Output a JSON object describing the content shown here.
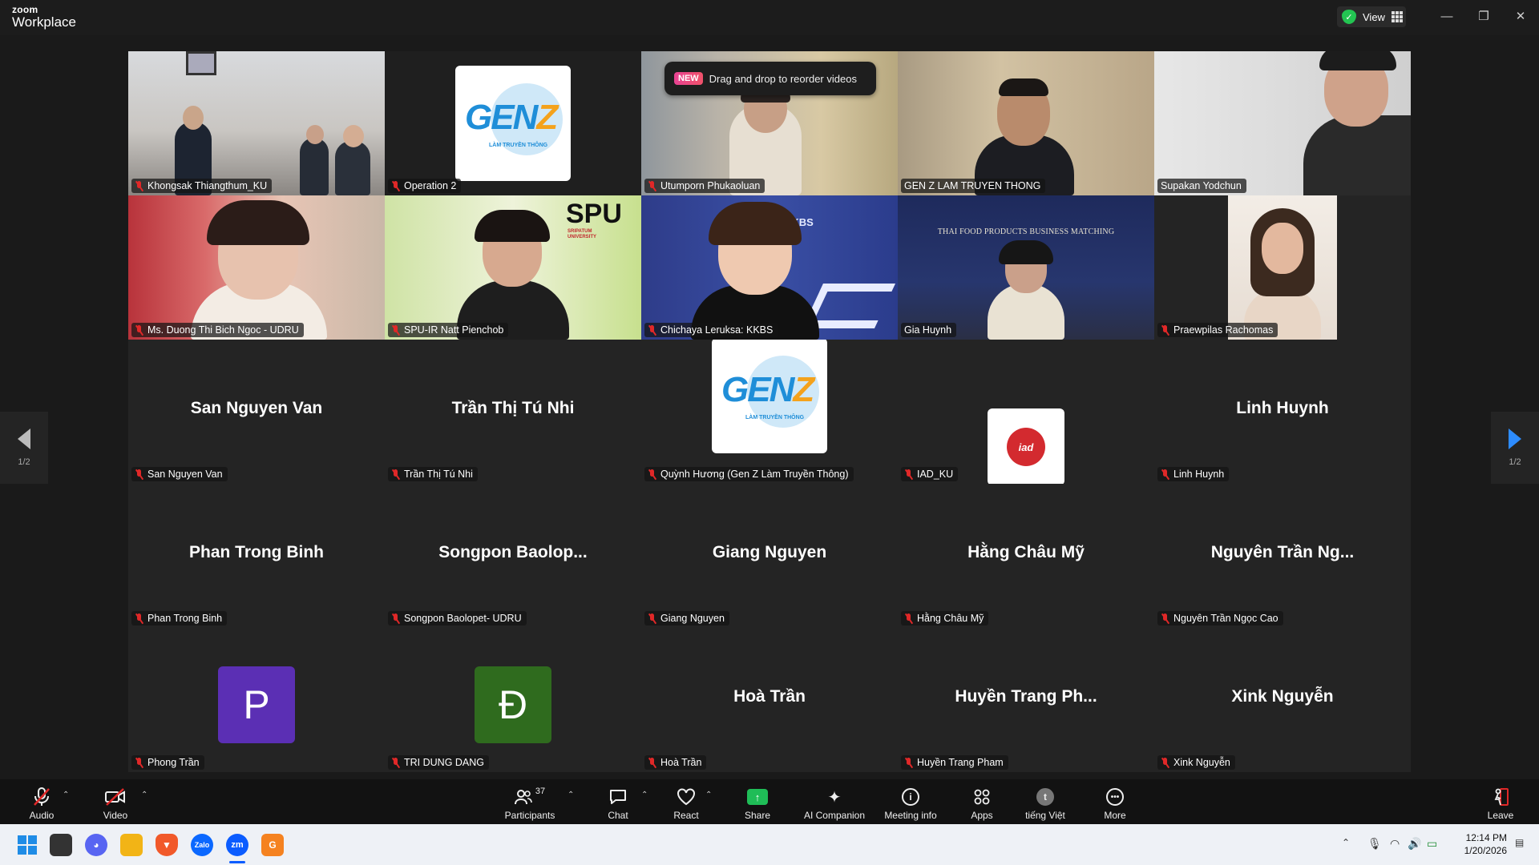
{
  "window": {
    "logo_small": "zoom",
    "logo_big": "Workplace",
    "view_label": "View",
    "minimize": "—",
    "restore": "❐",
    "close": "✕"
  },
  "toast": {
    "badge": "NEW",
    "text": "Drag and drop to reorder videos"
  },
  "pager": {
    "left_label": "1/2",
    "right_label": "1/2"
  },
  "video_tiles": [
    {
      "name": "Khongsak Thiangthum_KU",
      "muted": true
    },
    {
      "name": "Operation 2",
      "muted": true
    },
    {
      "name": "Utumporn Phukaoluan",
      "muted": true
    },
    {
      "name": "GEN Z LAM TRUYEN THONG",
      "muted": false
    },
    {
      "name": "Supakan Yodchun",
      "muted": false
    },
    {
      "name": "Ms. Duong Thi Bich Ngoc - UDRU",
      "muted": true
    },
    {
      "name": "SPU-IR Natt Pienchob",
      "muted": true
    },
    {
      "name": "Chichaya Leruksa: KKBS",
      "muted": true
    },
    {
      "name": "Gia Huynh",
      "muted": false
    },
    {
      "name": "Praewpilas Rachomas",
      "muted": true
    }
  ],
  "tile_texts": {
    "genz_logo": "GEN",
    "genz_z": "Z",
    "genz_sub": "LÀM TRUYỀN THÔNG",
    "spu_logo": "SPU",
    "spu_sub": "SRIPATUM UNIVERSITY",
    "kkbs_logo": "KKBS",
    "gia_banner": "THAI FOOD PRODUCTS BUSINESS MATCHING",
    "iad_logo": "iad"
  },
  "audio_tiles": [
    {
      "display": "San Nguyen Van",
      "name": "San Nguyen Van"
    },
    {
      "display": "Trần Thị Tú Nhi",
      "name": "Trần Thị Tú Nhi"
    },
    {
      "display": "",
      "name": "Quỳnh Hương (Gen Z Làm Truyền Thông)"
    },
    {
      "display": "",
      "name": "IAD_KU"
    },
    {
      "display": "Linh Huynh",
      "name": "Linh Huynh"
    },
    {
      "display": "Phan Trong Binh",
      "name": "Phan Trong Binh"
    },
    {
      "display": "Songpon  Baolop...",
      "name": "Songpon Baolopet- UDRU"
    },
    {
      "display": "Giang Nguyen",
      "name": "Giang Nguyen"
    },
    {
      "display": "Hằng Châu Mỹ",
      "name": "Hằng Châu Mỹ"
    },
    {
      "display": "Nguyên Trần Ng...",
      "name": "Nguyên Trần Ngọc Cao"
    },
    {
      "display": "P",
      "name": "Phong Trần"
    },
    {
      "display": "Đ",
      "name": "TRI DUNG DANG"
    },
    {
      "display": "Hoà Trần",
      "name": "Hoà Trần"
    },
    {
      "display": "Huyền Trang Ph...",
      "name": "Huyền Trang Pham"
    },
    {
      "display": "Xink Nguyễn",
      "name": "Xink Nguyễn"
    }
  ],
  "colors": {
    "avatar_p": "#5b2fb4",
    "avatar_d": "#2f6b1e",
    "active_border": "#23d18b",
    "muted_red": "#e02828"
  },
  "toolbar": {
    "audio": "Audio",
    "video": "Video",
    "participants": "Participants",
    "participants_count": "37",
    "chat": "Chat",
    "react": "React",
    "share": "Share",
    "ai": "AI Companion",
    "info": "Meeting info",
    "apps": "Apps",
    "lang": "tiếng Việt",
    "lang_icon": "t",
    "more": "More",
    "leave": "Leave"
  },
  "taskbar": {
    "time": "12:14 PM",
    "date": "1/20/2026",
    "zalo": "Zalo",
    "zoom": "zm"
  }
}
